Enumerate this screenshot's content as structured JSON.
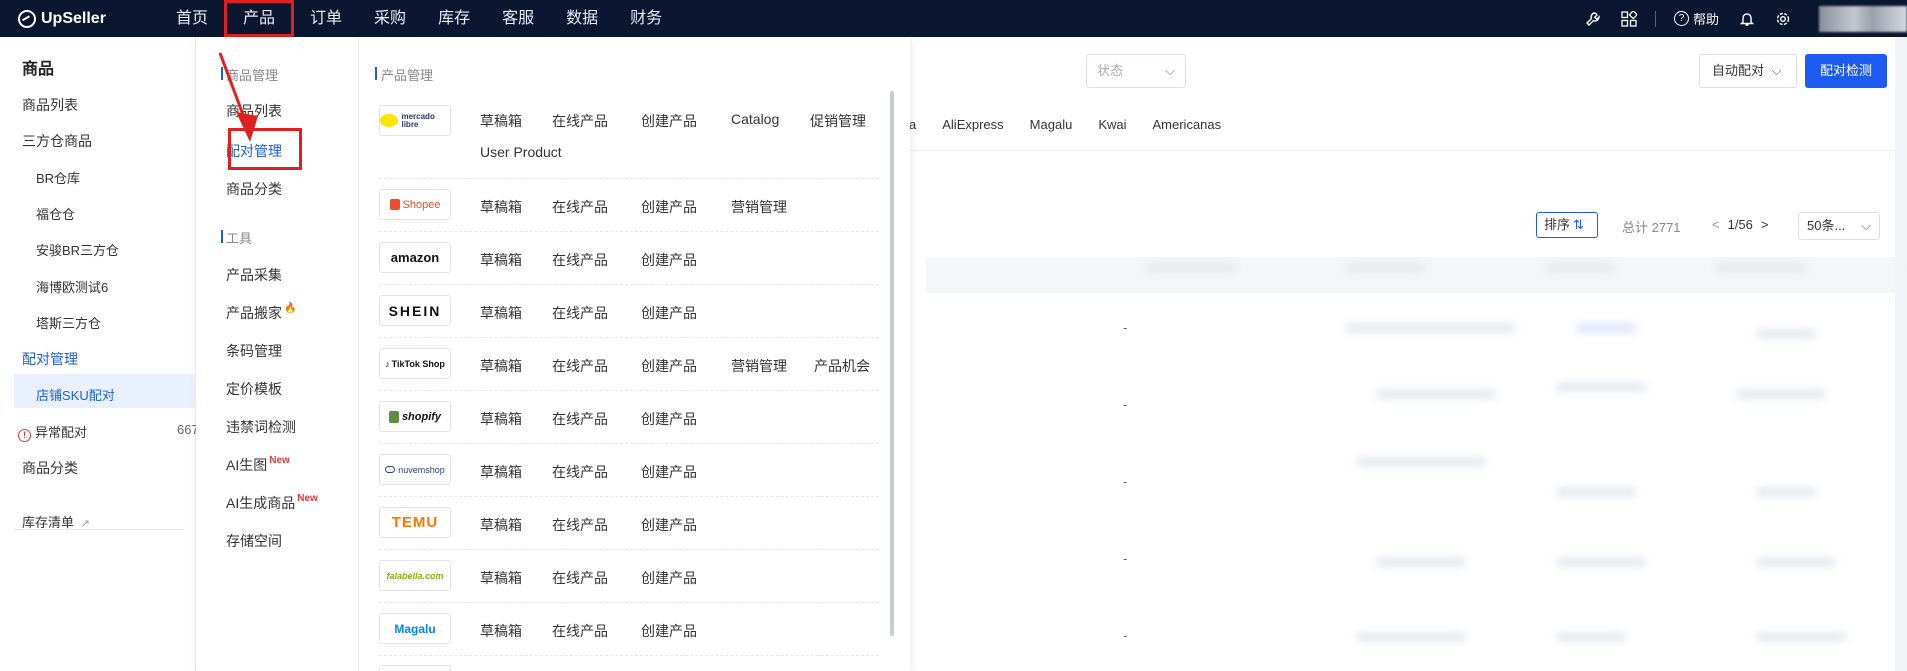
{
  "app": {
    "name": "UpSeller"
  },
  "topnav": {
    "items": [
      "首页",
      "产品",
      "订单",
      "采购",
      "库存",
      "客服",
      "数据",
      "财务"
    ],
    "active_index": 1,
    "help_label": "帮助",
    "icons": [
      "wrench-icon",
      "apps-icon",
      "help-icon",
      "bell-icon",
      "gear-icon"
    ]
  },
  "sidebar": {
    "title": "商品",
    "items": [
      {
        "label": "商品列表"
      },
      {
        "label": "三方仓商品"
      },
      {
        "label": "BR仓库",
        "sub": true
      },
      {
        "label": "福仓仓",
        "sub": true
      },
      {
        "label": "安骏BR三方仓",
        "sub": true
      },
      {
        "label": "海博欧测试6",
        "sub": true
      },
      {
        "label": "塔斯三方仓",
        "sub": true
      },
      {
        "label": "配对管理",
        "active": true
      },
      {
        "label": "店铺SKU配对",
        "sub": true,
        "selected": true
      },
      {
        "label": "异常配对",
        "count": "667"
      },
      {
        "label": "商品分类"
      },
      {
        "label": "库存清单"
      }
    ]
  },
  "main": {
    "status_placeholder": "状态",
    "auto_match_label": "自动配对",
    "detect_label": "配对检测",
    "platform_tabs": [
      "ella",
      "AliExpress",
      "Magalu",
      "Kwai",
      "Americanas"
    ],
    "sort_label": "排序",
    "total_label": "总计 2771",
    "pager": "1/56",
    "page_size": "50条..."
  },
  "dropdown": {
    "left_sections": [
      {
        "title": "商品管理",
        "items": [
          {
            "label": "商品列表"
          },
          {
            "label": "配对管理",
            "selected": true
          },
          {
            "label": "商品分类"
          }
        ]
      },
      {
        "title": "工具",
        "items": [
          {
            "label": "产品采集"
          },
          {
            "label": "产品搬家",
            "badge": "fire"
          },
          {
            "label": "条码管理"
          },
          {
            "label": "定价模板"
          },
          {
            "label": "违禁词检测"
          },
          {
            "label": "AI生图",
            "badge": "New"
          },
          {
            "label": "AI生成商品",
            "badge": "New"
          },
          {
            "label": "存储空间"
          }
        ]
      }
    ],
    "right_title": "产品管理",
    "platforms": [
      {
        "logo": "mercado libre",
        "links": [
          "草稿箱",
          "在线产品",
          "创建产品",
          "Catalog",
          "促销管理",
          "User Product"
        ]
      },
      {
        "logo": "Shopee",
        "links": [
          "草稿箱",
          "在线产品",
          "创建产品",
          "营销管理"
        ]
      },
      {
        "logo": "amazon",
        "links": [
          "草稿箱",
          "在线产品",
          "创建产品"
        ]
      },
      {
        "logo": "SHEIN",
        "links": [
          "草稿箱",
          "在线产品",
          "创建产品"
        ]
      },
      {
        "logo": "TikTok Shop",
        "links": [
          "草稿箱",
          "在线产品",
          "创建产品",
          "营销管理",
          "产品机会"
        ]
      },
      {
        "logo": "shopify",
        "links": [
          "草稿箱",
          "在线产品",
          "创建产品"
        ]
      },
      {
        "logo": "nuvemshop",
        "links": [
          "草稿箱",
          "在线产品",
          "创建产品"
        ]
      },
      {
        "logo": "TEMU",
        "links": [
          "草稿箱",
          "在线产品",
          "创建产品"
        ]
      },
      {
        "logo": "falabella.com",
        "links": [
          "草稿箱",
          "在线产品",
          "创建产品"
        ]
      },
      {
        "logo": "Magalu",
        "links": [
          "草稿箱",
          "在线产品",
          "创建产品"
        ]
      }
    ]
  },
  "colors": {
    "nav_bg": "#0b1630",
    "accent": "#1d5bf0",
    "highlight": "#e02020"
  }
}
